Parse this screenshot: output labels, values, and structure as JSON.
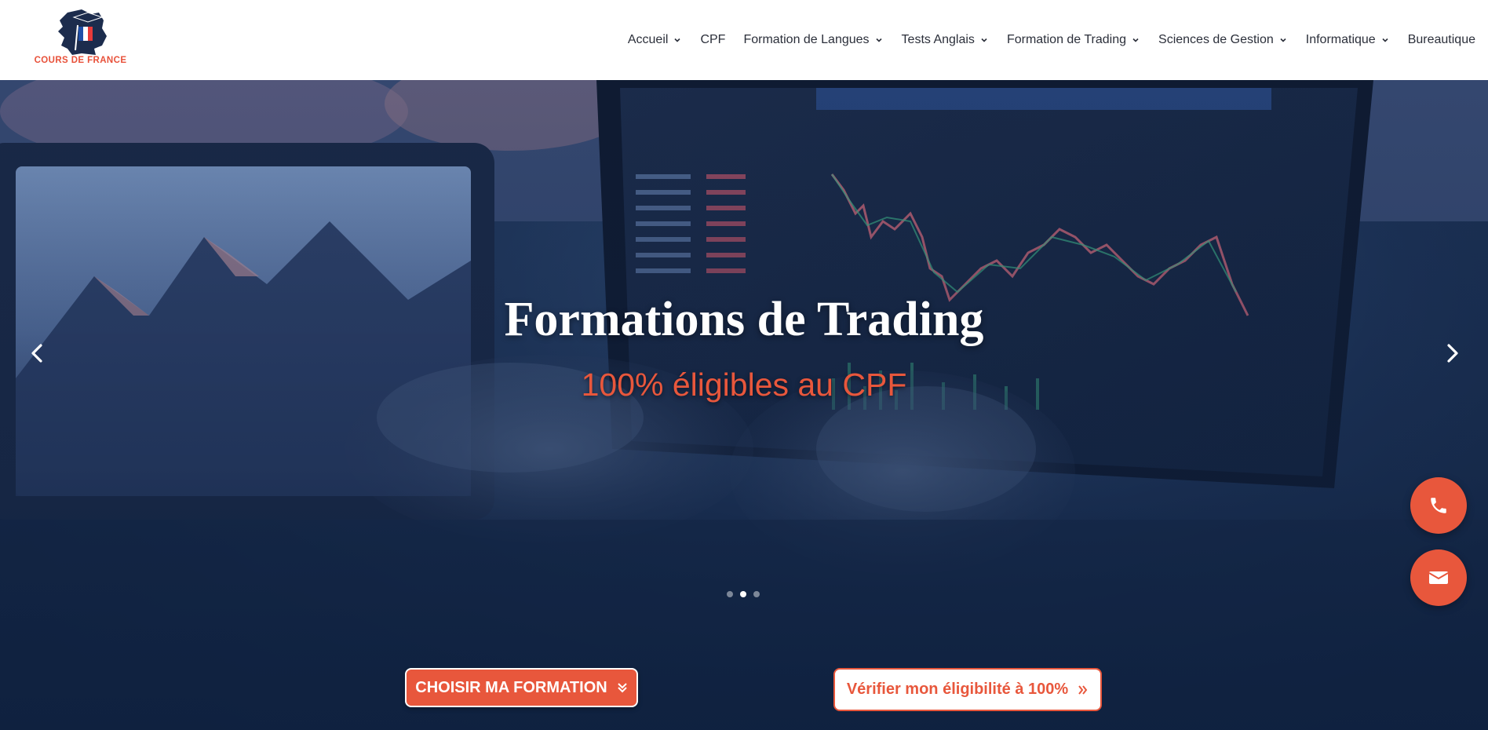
{
  "brand": {
    "name": "COURS DE FRANCE"
  },
  "nav": {
    "items": [
      {
        "label": "Accueil",
        "has_dropdown": true
      },
      {
        "label": "CPF",
        "has_dropdown": false
      },
      {
        "label": "Formation de Langues",
        "has_dropdown": true
      },
      {
        "label": "Tests Anglais",
        "has_dropdown": true
      },
      {
        "label": "Formation de Trading",
        "has_dropdown": true
      },
      {
        "label": "Sciences de Gestion",
        "has_dropdown": true
      },
      {
        "label": "Informatique",
        "has_dropdown": true
      },
      {
        "label": "Bureautique",
        "has_dropdown": false
      }
    ]
  },
  "hero": {
    "title": "Formations de Trading",
    "subtitle": "100% éligibles au CPF",
    "slides_count": 3,
    "active_slide": 2,
    "primary_button": {
      "label": "CHOISIR MA FORMATION",
      "icon": "double-chevron-down-icon"
    },
    "secondary_button": {
      "label": "Vérifier mon éligibilité à 100%",
      "icon": "double-chevron-right-icon"
    }
  },
  "floating_actions": [
    {
      "name": "phone",
      "icon": "phone-icon"
    },
    {
      "name": "email",
      "icon": "mail-icon"
    }
  ],
  "colors": {
    "accent": "#e8573c",
    "nav_text": "#2b2f3a",
    "hero_dark": "#152847",
    "white": "#ffffff"
  }
}
